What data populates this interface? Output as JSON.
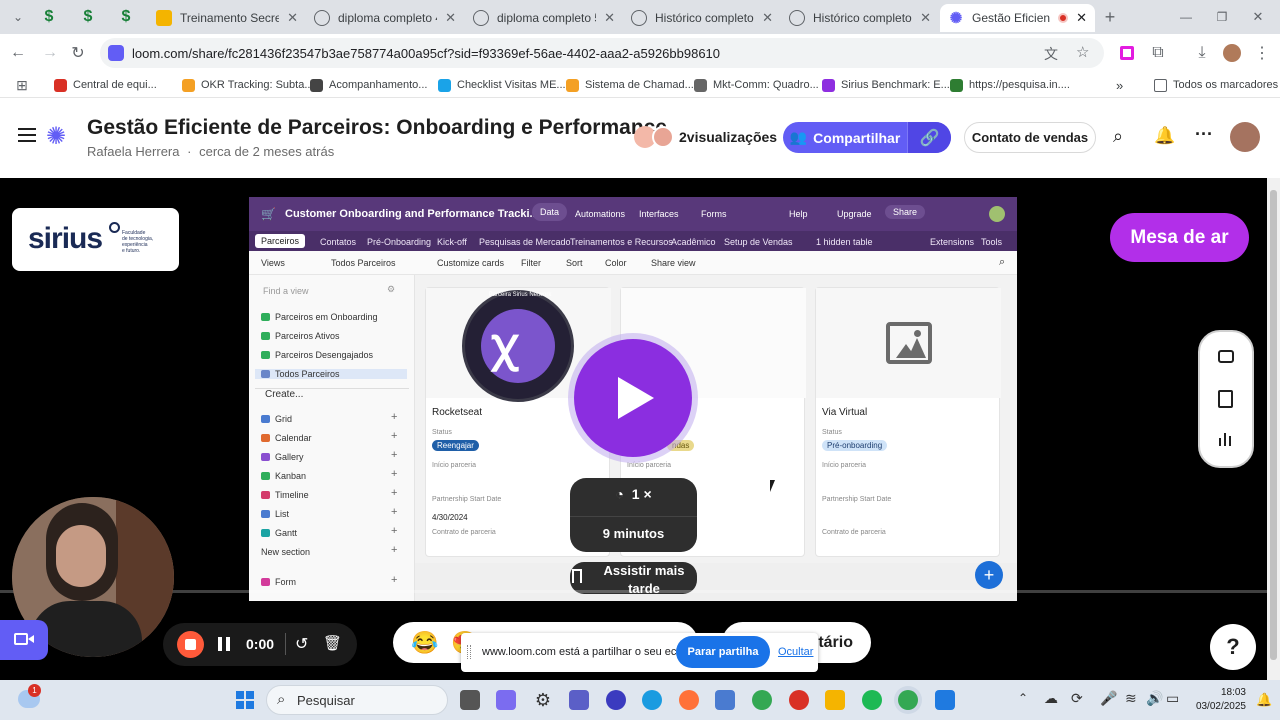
{
  "browser": {
    "tabs": [
      {
        "title": "Treinamento Secretari",
        "icon": "slides-icon",
        "color": "#f4b400"
      },
      {
        "title": "diploma completo 4 C",
        "icon": "globe-icon",
        "color": "#5f6368"
      },
      {
        "title": "diploma completo 5 -",
        "icon": "globe-icon",
        "color": "#5f6368"
      },
      {
        "title": "Histórico completo.pd",
        "icon": "globe-icon",
        "color": "#5f6368"
      },
      {
        "title": "Histórico completo - a",
        "icon": "globe-icon",
        "color": "#5f6368"
      },
      {
        "title": "Gestão Eficiente d",
        "icon": "loom-icon",
        "color": "#625df5"
      }
    ],
    "url": "loom.com/share/fc281436f23547b3ae758774a00a95cf?sid=f93369ef-56ae-4402-aaa2-a5926bb98610",
    "bookmarks": [
      {
        "label": "Central de equi...",
        "color": "#d93025"
      },
      {
        "label": "OKR Tracking: Subta...",
        "color": "#f4a024"
      },
      {
        "label": "Acompanhamento...",
        "color": "#444444"
      },
      {
        "label": "Checklist Visitas ME...",
        "color": "#1aa3e8"
      },
      {
        "label": "Sistema de Chamad...",
        "color": "#f4a024"
      },
      {
        "label": "Mkt-Comm: Quadro...",
        "color": "#666666"
      },
      {
        "label": "Sirius Benchmark: E...",
        "color": "#8e2ee0"
      },
      {
        "label": "https://pesquisa.in....",
        "color": "#2e7d32"
      }
    ],
    "bookmarks_all": "Todos os marcadores"
  },
  "loom": {
    "title": "Gestão Eficiente de Parceiros: Onboarding e Performance",
    "author": "Rafaela Herrera",
    "time_ago": "cerca de 2 meses atrás",
    "views": "2visualizações",
    "share_label": "Compartilhar",
    "sales_label": "Contato de vendas",
    "accent": "#625df5"
  },
  "video": {
    "logo_text": "sirius",
    "logo_tagline": [
      "Faculdade",
      "de tecnologia,",
      "experiência",
      "e futuro."
    ],
    "banner": "Mesa de ar",
    "speed": "1 ×",
    "duration": "9 minutos",
    "watch_later": "Assistir mais tarde",
    "recording": {
      "base_title": "Customer Onboarding and Performance Tracki...",
      "top_nav": [
        "Data",
        "Automations",
        "Interfaces",
        "Forms",
        "Help",
        "Upgrade",
        "Share"
      ],
      "table_tabs": [
        "Parceiros",
        "Contatos",
        "Pré-Onboarding",
        "Kick-off",
        "Pesquisas de Mercado",
        "Treinamentos e Recursos",
        "Acadêmico",
        "Setup de Vendas",
        "1 hidden table",
        "Extensions",
        "Tools"
      ],
      "toolbar": [
        "Views",
        "Todos Parceiros",
        "Customize cards",
        "Filter",
        "Sort",
        "Color",
        "Share view"
      ],
      "find_placeholder": "Find a view",
      "views": [
        "Parceiros em Onboarding",
        "Parceiros Ativos",
        "Parceiros Desengajados",
        "Todos Parceiros"
      ],
      "create_label": "Create...",
      "create_items": [
        "Grid",
        "Calendar",
        "Gallery",
        "Kanban",
        "Timeline",
        "List",
        "Gantt",
        "New section",
        "Form"
      ],
      "badge_text": "Parceira Sirius Network",
      "cards": [
        {
          "name": "Rocketseat",
          "status": "Reengajar",
          "status_color": "#1f5fa8",
          "start_date": "4/30/2024"
        },
        {
          "name": "",
          "status": "ndas",
          "status_color": "#e9d98c",
          "start_date": ""
        },
        {
          "name": "Via Virtual",
          "status": "Pré-onboarding",
          "status_color": "#cfe3f8",
          "start_date": ""
        }
      ],
      "field_labels": {
        "status": "Status",
        "inicio": "Início parceria",
        "start": "Partnership Start Date",
        "contrato": "Contrato de parceria"
      }
    }
  },
  "recorder": {
    "timer": "0:00"
  },
  "comment_label": "tário",
  "share_notice": {
    "text": "www.loom.com está a partilhar o seu ecrã.",
    "stop": "Parar partilha",
    "hide": "Ocultar"
  },
  "taskbar": {
    "search_placeholder": "Pesquisar",
    "time": "18:03",
    "date": "03/02/2025",
    "weather_badge": "1"
  }
}
